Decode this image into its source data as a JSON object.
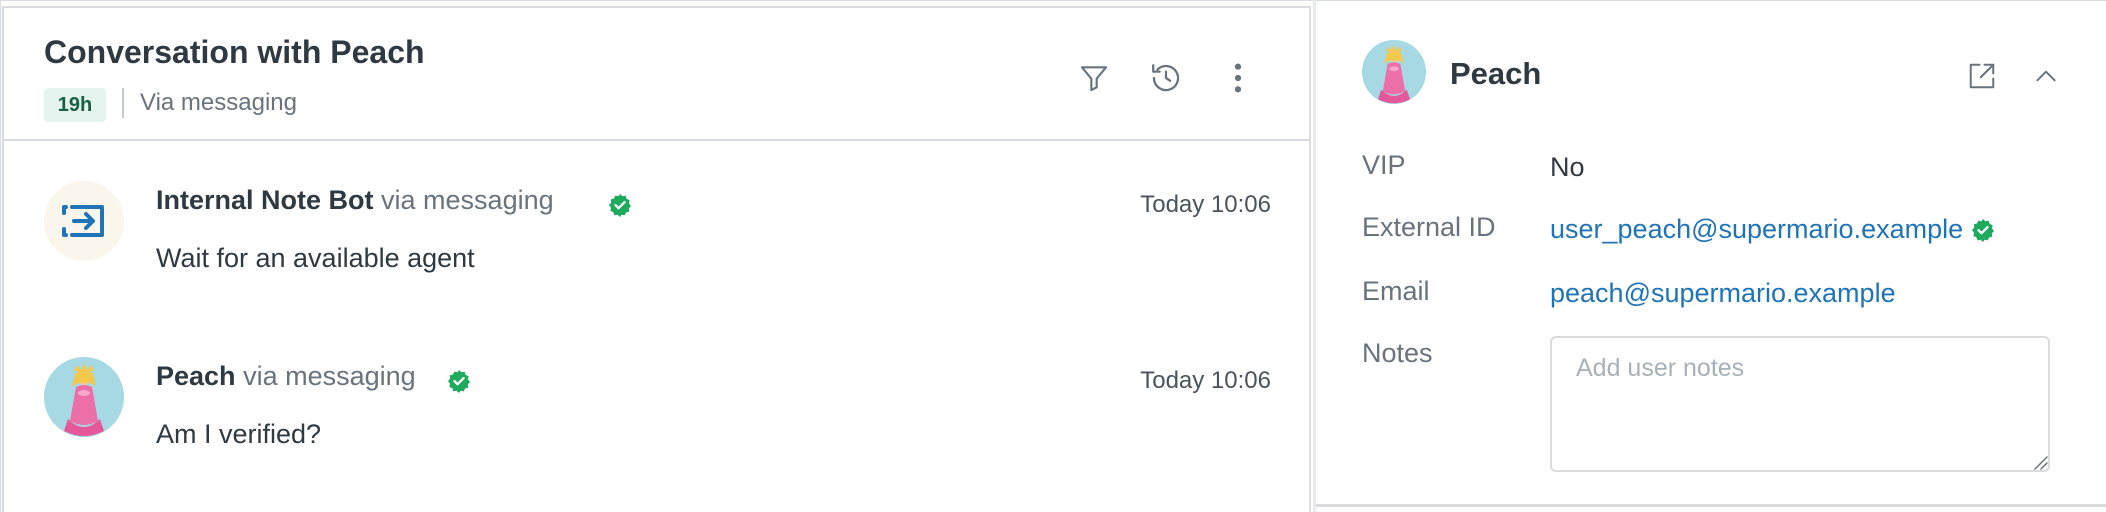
{
  "conversation": {
    "title": "Conversation with Peach",
    "age_badge": "19h",
    "channel": "Via messaging",
    "icons": [
      "filter-icon",
      "history-icon",
      "more-options-icon"
    ]
  },
  "messages": [
    {
      "sender": "Internal Note Bot",
      "via": "via messaging",
      "time": "Today 10:06",
      "text": "Wait for an available agent",
      "avatar": "bot-icon"
    },
    {
      "sender": "Peach",
      "via": "via messaging",
      "time": "Today 10:06",
      "text": "Am I verified?",
      "avatar": "peach-avatar"
    }
  ],
  "user_panel": {
    "name": "Peach",
    "icons": [
      "open-external-icon",
      "chevron-up-icon"
    ],
    "fields": [
      {
        "label": "VIP",
        "value": "No"
      },
      {
        "label": "External ID",
        "value": "user_peach@supermario.example"
      },
      {
        "label": "Email",
        "value": "peach@supermario.example"
      },
      {
        "label": "Notes",
        "placeholder": "Add user notes"
      }
    ]
  },
  "colors": {
    "verified_green": "#1eaa5c",
    "link_blue": "#1f73b7",
    "bot_blue": "#1f73b7",
    "badge_bg": "#e5f4ee",
    "badge_text": "#186146",
    "avatar_bg": "#a6d9e4"
  }
}
